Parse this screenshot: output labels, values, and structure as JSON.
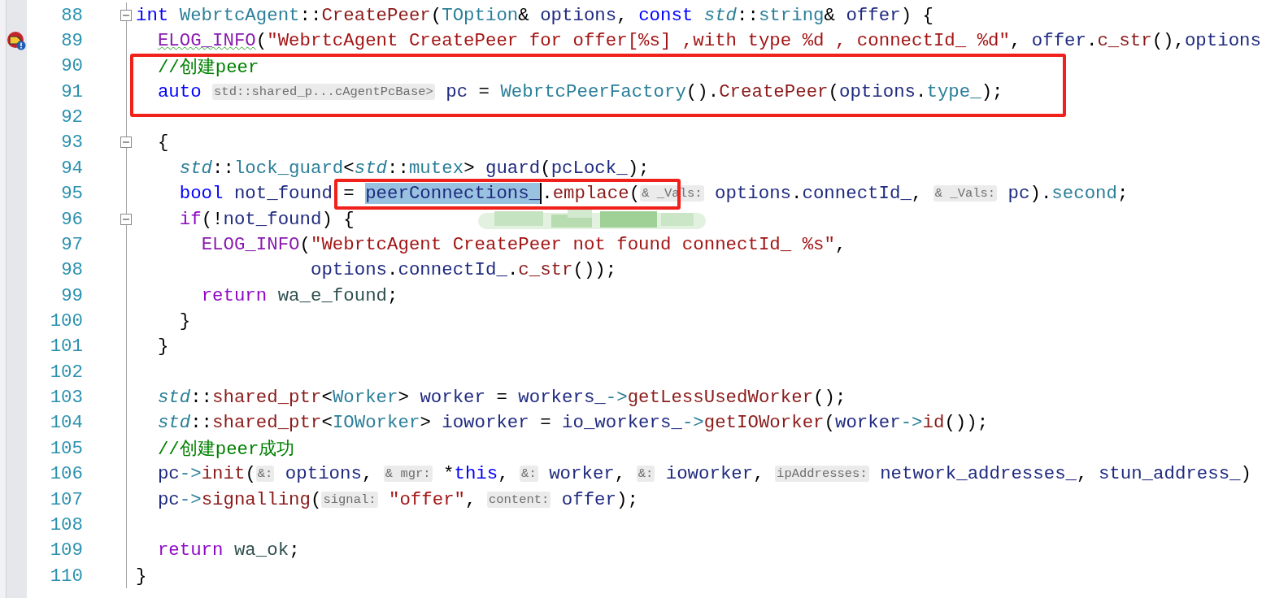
{
  "editor": {
    "lines": [
      {
        "number": "88",
        "fold": {
          "expanded": true
        },
        "tokens": [
          {
            "kind": "kw",
            "text": "int"
          },
          {
            "kind": "type",
            "text": " WebrtcAgent"
          },
          {
            "kind": "op",
            "text": "::"
          },
          {
            "kind": "fn",
            "text": "CreatePeer"
          },
          {
            "kind": "op",
            "text": "("
          },
          {
            "kind": "type",
            "text": "TOption"
          },
          {
            "kind": "op",
            "text": "& "
          },
          {
            "kind": "var",
            "text": "options"
          },
          {
            "kind": "op",
            "text": ", "
          },
          {
            "kind": "kw",
            "text": "const"
          },
          {
            "kind": "ns",
            "text": " std"
          },
          {
            "kind": "op",
            "text": "::"
          },
          {
            "kind": "type",
            "text": "string"
          },
          {
            "kind": "op",
            "text": "& "
          },
          {
            "kind": "var",
            "text": "offer"
          },
          {
            "kind": "op",
            "text": ") {"
          }
        ]
      },
      {
        "number": "89",
        "breakpoint": true,
        "tokens": [
          {
            "kind": "macro",
            "text": "  ELOG_INFO",
            "squiggle": true
          },
          {
            "kind": "op",
            "text": "("
          },
          {
            "kind": "str",
            "text": "\"WebrtcAgent CreatePeer for offer[%s] ,with type %d , connectId_ %d\""
          },
          {
            "kind": "op",
            "text": ", "
          },
          {
            "kind": "var",
            "text": "offer"
          },
          {
            "kind": "op",
            "text": "."
          },
          {
            "kind": "fn",
            "text": "c_str"
          },
          {
            "kind": "op",
            "text": "(),"
          },
          {
            "kind": "var",
            "text": "options"
          }
        ]
      },
      {
        "number": "90",
        "tokens": [
          {
            "kind": "cmt",
            "text": "  //创建peer"
          }
        ]
      },
      {
        "number": "91",
        "tokens": [
          {
            "kind": "kw",
            "text": "  auto"
          },
          {
            "kind": "hint",
            "text": " std::shared_p...cAgentPcBase>"
          },
          {
            "kind": "var",
            "text": " pc"
          },
          {
            "kind": "op",
            "text": " = "
          },
          {
            "kind": "type",
            "text": "WebrtcPeerFactory"
          },
          {
            "kind": "op",
            "text": "()."
          },
          {
            "kind": "fn",
            "text": "CreatePeer"
          },
          {
            "kind": "op",
            "text": "("
          },
          {
            "kind": "var",
            "text": "options"
          },
          {
            "kind": "op",
            "text": "."
          },
          {
            "kind": "field",
            "text": "type_"
          },
          {
            "kind": "op",
            "text": ");"
          }
        ]
      },
      {
        "number": "92"
      },
      {
        "number": "93",
        "fold": {
          "expanded": true
        },
        "tokens": [
          {
            "kind": "op",
            "text": "  {"
          }
        ]
      },
      {
        "number": "94",
        "tokens": [
          {
            "kind": "ns",
            "text": "    std"
          },
          {
            "kind": "op",
            "text": "::"
          },
          {
            "kind": "type",
            "text": "lock_guard"
          },
          {
            "kind": "op",
            "text": "<"
          },
          {
            "kind": "ns",
            "text": "std"
          },
          {
            "kind": "op",
            "text": "::"
          },
          {
            "kind": "type",
            "text": "mutex"
          },
          {
            "kind": "op",
            "text": "> "
          },
          {
            "kind": "var",
            "text": "guard"
          },
          {
            "kind": "op",
            "text": "("
          },
          {
            "kind": "var",
            "text": "pcLock_"
          },
          {
            "kind": "op",
            "text": ");"
          }
        ]
      },
      {
        "number": "95",
        "tokens": [
          {
            "kind": "kw",
            "text": "    bool"
          },
          {
            "kind": "var",
            "text": " not_found"
          },
          {
            "kind": "op",
            "text": " = "
          },
          {
            "kind": "var",
            "text": "peerConnections_",
            "selected": true
          },
          {
            "kind": "op",
            "text": "."
          },
          {
            "kind": "fn",
            "text": "emplace"
          },
          {
            "kind": "op",
            "text": "("
          },
          {
            "kind": "hint",
            "text": "& _Vals:"
          },
          {
            "kind": "var",
            "text": " options"
          },
          {
            "kind": "op",
            "text": "."
          },
          {
            "kind": "var",
            "text": "connectId_"
          },
          {
            "kind": "op",
            "text": ", "
          },
          {
            "kind": "hint",
            "text": "& _Vals:"
          },
          {
            "kind": "var",
            "text": " pc"
          },
          {
            "kind": "op",
            "text": ")."
          },
          {
            "kind": "field",
            "text": "second"
          },
          {
            "kind": "op",
            "text": ";"
          }
        ]
      },
      {
        "number": "96",
        "fold": {
          "expanded": true
        },
        "tokens": [
          {
            "kind": "ctrl",
            "text": "    if"
          },
          {
            "kind": "op",
            "text": "(!"
          },
          {
            "kind": "var",
            "text": "not_found"
          },
          {
            "kind": "op",
            "text": ") {"
          }
        ]
      },
      {
        "number": "97",
        "tokens": [
          {
            "kind": "macro",
            "text": "      ELOG_INFO"
          },
          {
            "kind": "op",
            "text": "("
          },
          {
            "kind": "str",
            "text": "\"WebrtcAgent CreatePeer not found connectId_ %s\""
          },
          {
            "kind": "op",
            "text": ","
          }
        ]
      },
      {
        "number": "98",
        "tokens": [
          {
            "kind": "var",
            "text": "                options"
          },
          {
            "kind": "op",
            "text": "."
          },
          {
            "kind": "var",
            "text": "connectId_"
          },
          {
            "kind": "op",
            "text": "."
          },
          {
            "kind": "fn",
            "text": "c_str"
          },
          {
            "kind": "op",
            "text": "());"
          }
        ]
      },
      {
        "number": "99",
        "tokens": [
          {
            "kind": "ctrl",
            "text": "      return"
          },
          {
            "kind": "const",
            "text": " wa_e_found"
          },
          {
            "kind": "op",
            "text": ";"
          }
        ]
      },
      {
        "number": "100",
        "tokens": [
          {
            "kind": "op",
            "text": "    }"
          }
        ]
      },
      {
        "number": "101",
        "tokens": [
          {
            "kind": "op",
            "text": "  }"
          }
        ]
      },
      {
        "number": "102"
      },
      {
        "number": "103",
        "tokens": [
          {
            "kind": "ns",
            "text": "  std"
          },
          {
            "kind": "op",
            "text": "::"
          },
          {
            "kind": "fn",
            "text": "shared_ptr"
          },
          {
            "kind": "op",
            "text": "<"
          },
          {
            "kind": "type",
            "text": "Worker"
          },
          {
            "kind": "op",
            "text": "> "
          },
          {
            "kind": "var",
            "text": "worker"
          },
          {
            "kind": "op",
            "text": " = "
          },
          {
            "kind": "var",
            "text": "workers_"
          },
          {
            "kind": "type",
            "text": "->"
          },
          {
            "kind": "fn",
            "text": "getLessUsedWorker"
          },
          {
            "kind": "op",
            "text": "();"
          }
        ]
      },
      {
        "number": "104",
        "tokens": [
          {
            "kind": "ns",
            "text": "  std"
          },
          {
            "kind": "op",
            "text": "::"
          },
          {
            "kind": "fn",
            "text": "shared_ptr"
          },
          {
            "kind": "op",
            "text": "<"
          },
          {
            "kind": "type",
            "text": "IOWorker"
          },
          {
            "kind": "op",
            "text": "> "
          },
          {
            "kind": "var",
            "text": "ioworker"
          },
          {
            "kind": "op",
            "text": " = "
          },
          {
            "kind": "var",
            "text": "io_workers_"
          },
          {
            "kind": "type",
            "text": "->"
          },
          {
            "kind": "fn",
            "text": "getIOWorker"
          },
          {
            "kind": "op",
            "text": "("
          },
          {
            "kind": "var",
            "text": "worker"
          },
          {
            "kind": "type",
            "text": "->"
          },
          {
            "kind": "fn",
            "text": "id"
          },
          {
            "kind": "op",
            "text": "());"
          }
        ]
      },
      {
        "number": "105",
        "tokens": [
          {
            "kind": "cmt",
            "text": "  //创建peer成功"
          }
        ]
      },
      {
        "number": "106",
        "tokens": [
          {
            "kind": "var",
            "text": "  pc"
          },
          {
            "kind": "type",
            "text": "->"
          },
          {
            "kind": "fn",
            "text": "init"
          },
          {
            "kind": "op",
            "text": "("
          },
          {
            "kind": "hint",
            "text": "&:"
          },
          {
            "kind": "var",
            "text": " options"
          },
          {
            "kind": "op",
            "text": ", "
          },
          {
            "kind": "hint",
            "text": "& mgr:"
          },
          {
            "kind": "op",
            "text": " *"
          },
          {
            "kind": "kw",
            "text": "this"
          },
          {
            "kind": "op",
            "text": ", "
          },
          {
            "kind": "hint",
            "text": "&:"
          },
          {
            "kind": "var",
            "text": " worker"
          },
          {
            "kind": "op",
            "text": ", "
          },
          {
            "kind": "hint",
            "text": "&:"
          },
          {
            "kind": "var",
            "text": " ioworker"
          },
          {
            "kind": "op",
            "text": ", "
          },
          {
            "kind": "hint",
            "text": "ipAddresses:"
          },
          {
            "kind": "var",
            "text": " network_addresses_"
          },
          {
            "kind": "op",
            "text": ", "
          },
          {
            "kind": "var",
            "text": "stun_address_"
          },
          {
            "kind": "op",
            "text": ")"
          }
        ]
      },
      {
        "number": "107",
        "tokens": [
          {
            "kind": "var",
            "text": "  pc"
          },
          {
            "kind": "type",
            "text": "->"
          },
          {
            "kind": "fn",
            "text": "signalling"
          },
          {
            "kind": "op",
            "text": "("
          },
          {
            "kind": "hint",
            "text": "signal:"
          },
          {
            "kind": "str",
            "text": " \"offer\""
          },
          {
            "kind": "op",
            "text": ", "
          },
          {
            "kind": "hint",
            "text": "content:"
          },
          {
            "kind": "var",
            "text": " offer"
          },
          {
            "kind": "op",
            "text": ");"
          }
        ]
      },
      {
        "number": "108"
      },
      {
        "number": "109",
        "tokens": [
          {
            "kind": "ctrl",
            "text": "  return"
          },
          {
            "kind": "const",
            "text": " wa_ok"
          },
          {
            "kind": "op",
            "text": ";"
          }
        ]
      },
      {
        "number": "110",
        "tokens": [
          {
            "kind": "op",
            "text": "}"
          }
        ]
      }
    ],
    "annotations": [
      {
        "kind": "box"
      },
      {
        "kind": "box"
      },
      {
        "kind": "scribble"
      }
    ]
  }
}
